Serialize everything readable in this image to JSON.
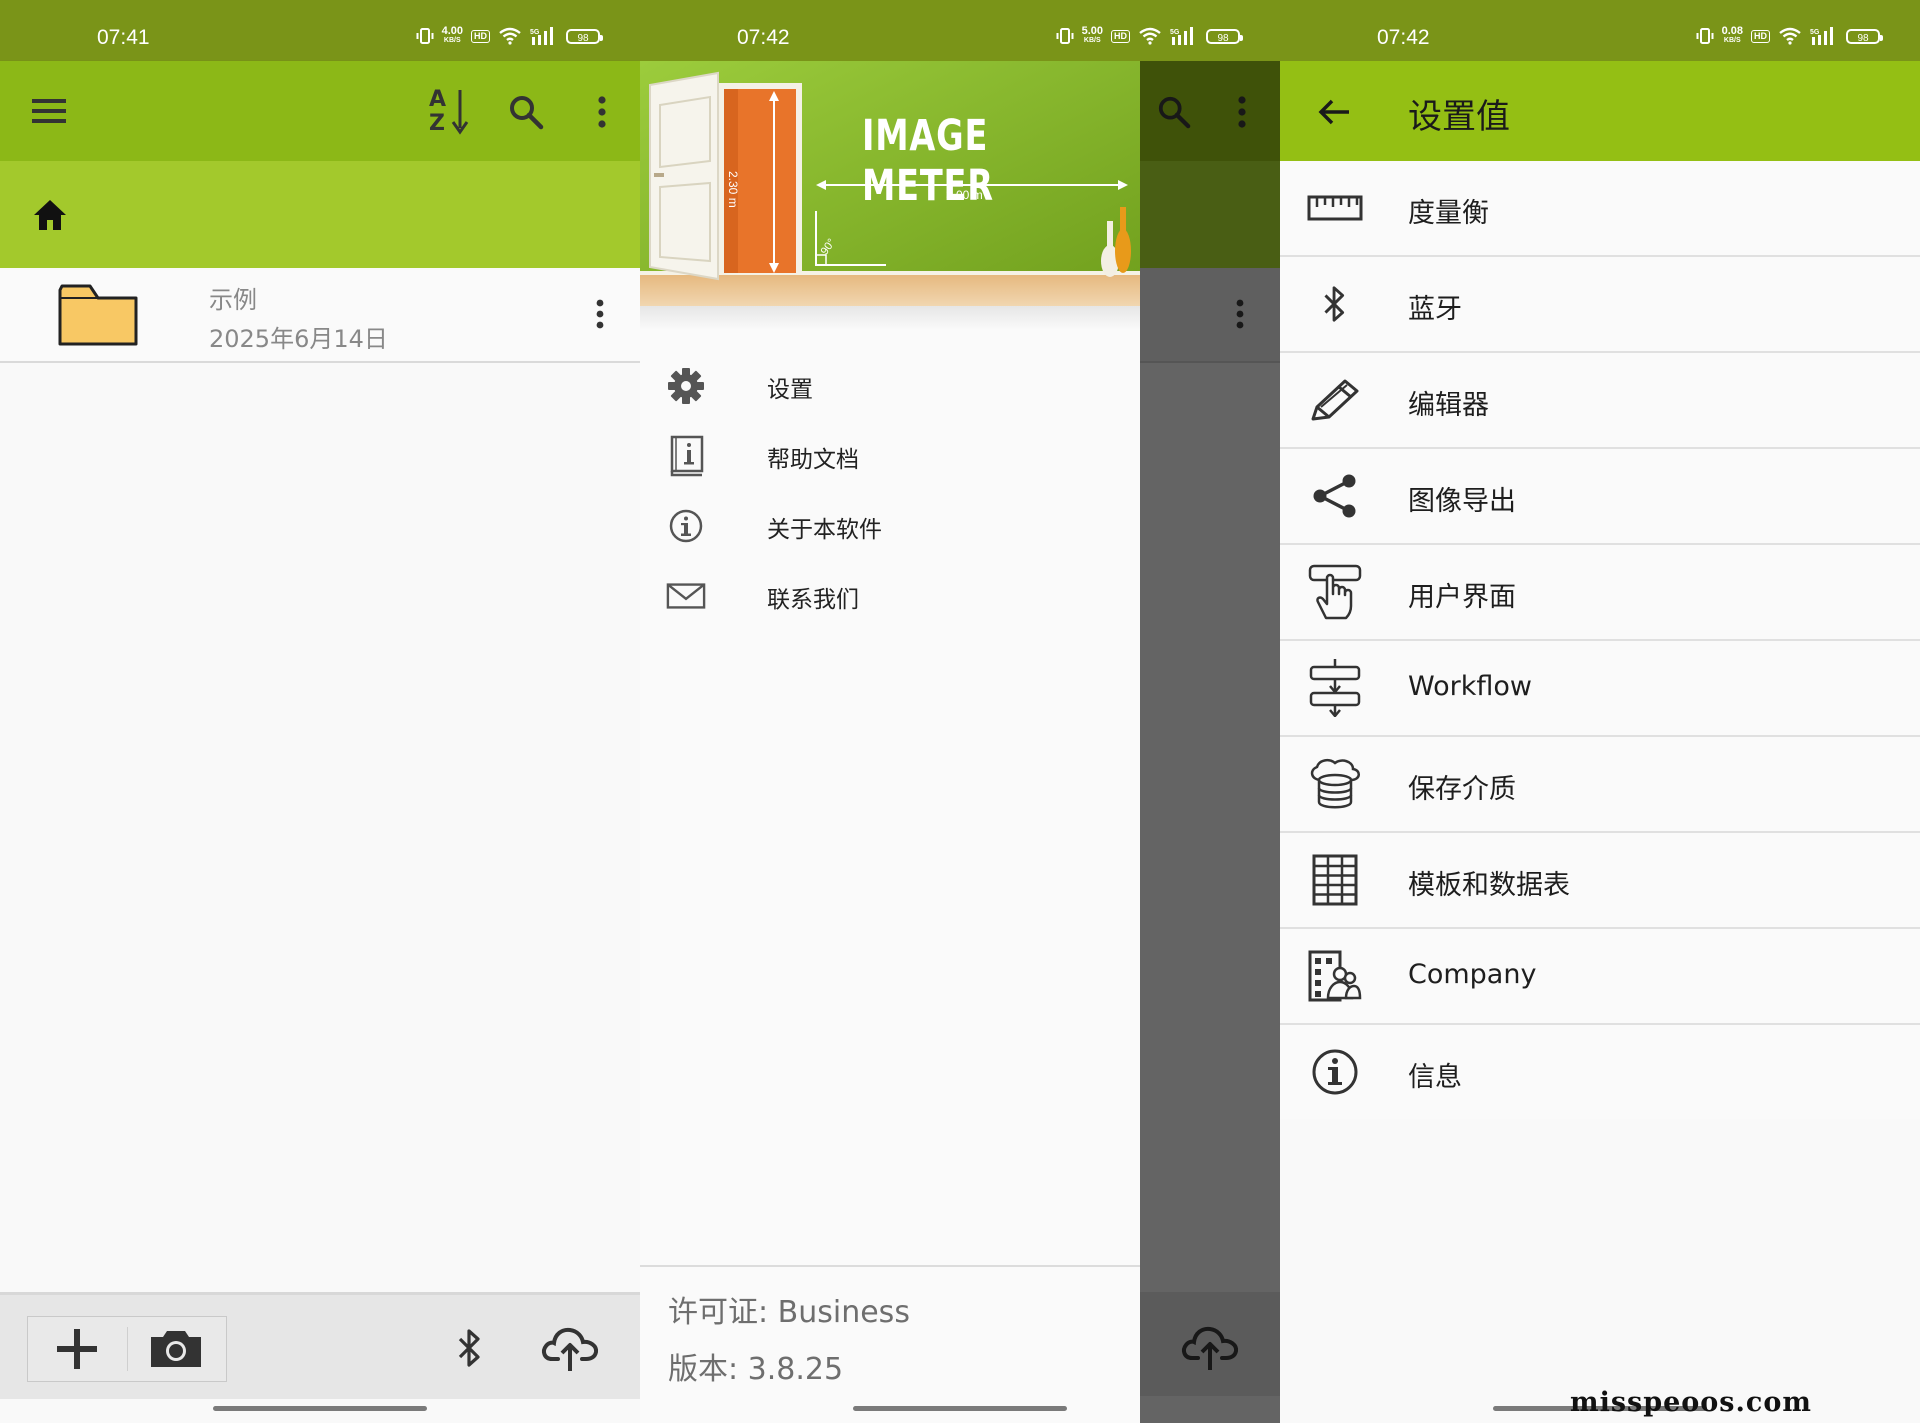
{
  "colors": {
    "statusbar": "#7a9418",
    "toolbar": "#8cb817",
    "breadcrumb": "#a3c92c",
    "folder": "#f8c864"
  },
  "panel1": {
    "status_time": "07:41",
    "status_speed": "4.00",
    "status_speed_unit": "KB/S",
    "battery": "98",
    "toolbar_icons": [
      "menu-icon",
      "sort-az-icon",
      "search-icon",
      "more-vert-icon"
    ],
    "file": {
      "name": "示例",
      "date": "2025年6月14日"
    },
    "bottom_icons": [
      "add-icon",
      "camera-icon",
      "bluetooth-icon",
      "cloud-upload-icon"
    ]
  },
  "panel2": {
    "status_time": "07:42",
    "status_speed": "5.00",
    "status_speed_unit": "KB/S",
    "battery": "98",
    "banner": {
      "title": "IMAGE METER",
      "height_label": "2.30 m",
      "width_label": "3.00 m",
      "angle_label": "90°"
    },
    "menu": [
      {
        "icon": "gear-icon",
        "label": "设置"
      },
      {
        "icon": "help-book-icon",
        "label": "帮助文档"
      },
      {
        "icon": "info-icon",
        "label": "关于本软件"
      },
      {
        "icon": "mail-icon",
        "label": "联系我们"
      }
    ],
    "license_label": "许可证:",
    "license_value": "Business",
    "version_label": "版本:",
    "version_value": "3.8.25"
  },
  "panel3": {
    "status_time": "07:42",
    "status_speed": "0.08",
    "status_speed_unit": "KB/S",
    "battery": "98",
    "title": "设置值",
    "items": [
      {
        "icon": "ruler-icon",
        "label": "度量衡"
      },
      {
        "icon": "bluetooth-icon",
        "label": "蓝牙"
      },
      {
        "icon": "pencil-icon",
        "label": "编辑器"
      },
      {
        "icon": "share-icon",
        "label": "图像导出"
      },
      {
        "icon": "touch-hand-icon",
        "label": "用户界面"
      },
      {
        "icon": "workflow-icon",
        "label": "Workflow"
      },
      {
        "icon": "storage-icon",
        "label": "保存介质"
      },
      {
        "icon": "grid-table-icon",
        "label": "模板和数据表"
      },
      {
        "icon": "company-icon",
        "label": "Company"
      },
      {
        "icon": "info-icon",
        "label": "信息"
      }
    ]
  },
  "watermark": "misspeoos.com"
}
